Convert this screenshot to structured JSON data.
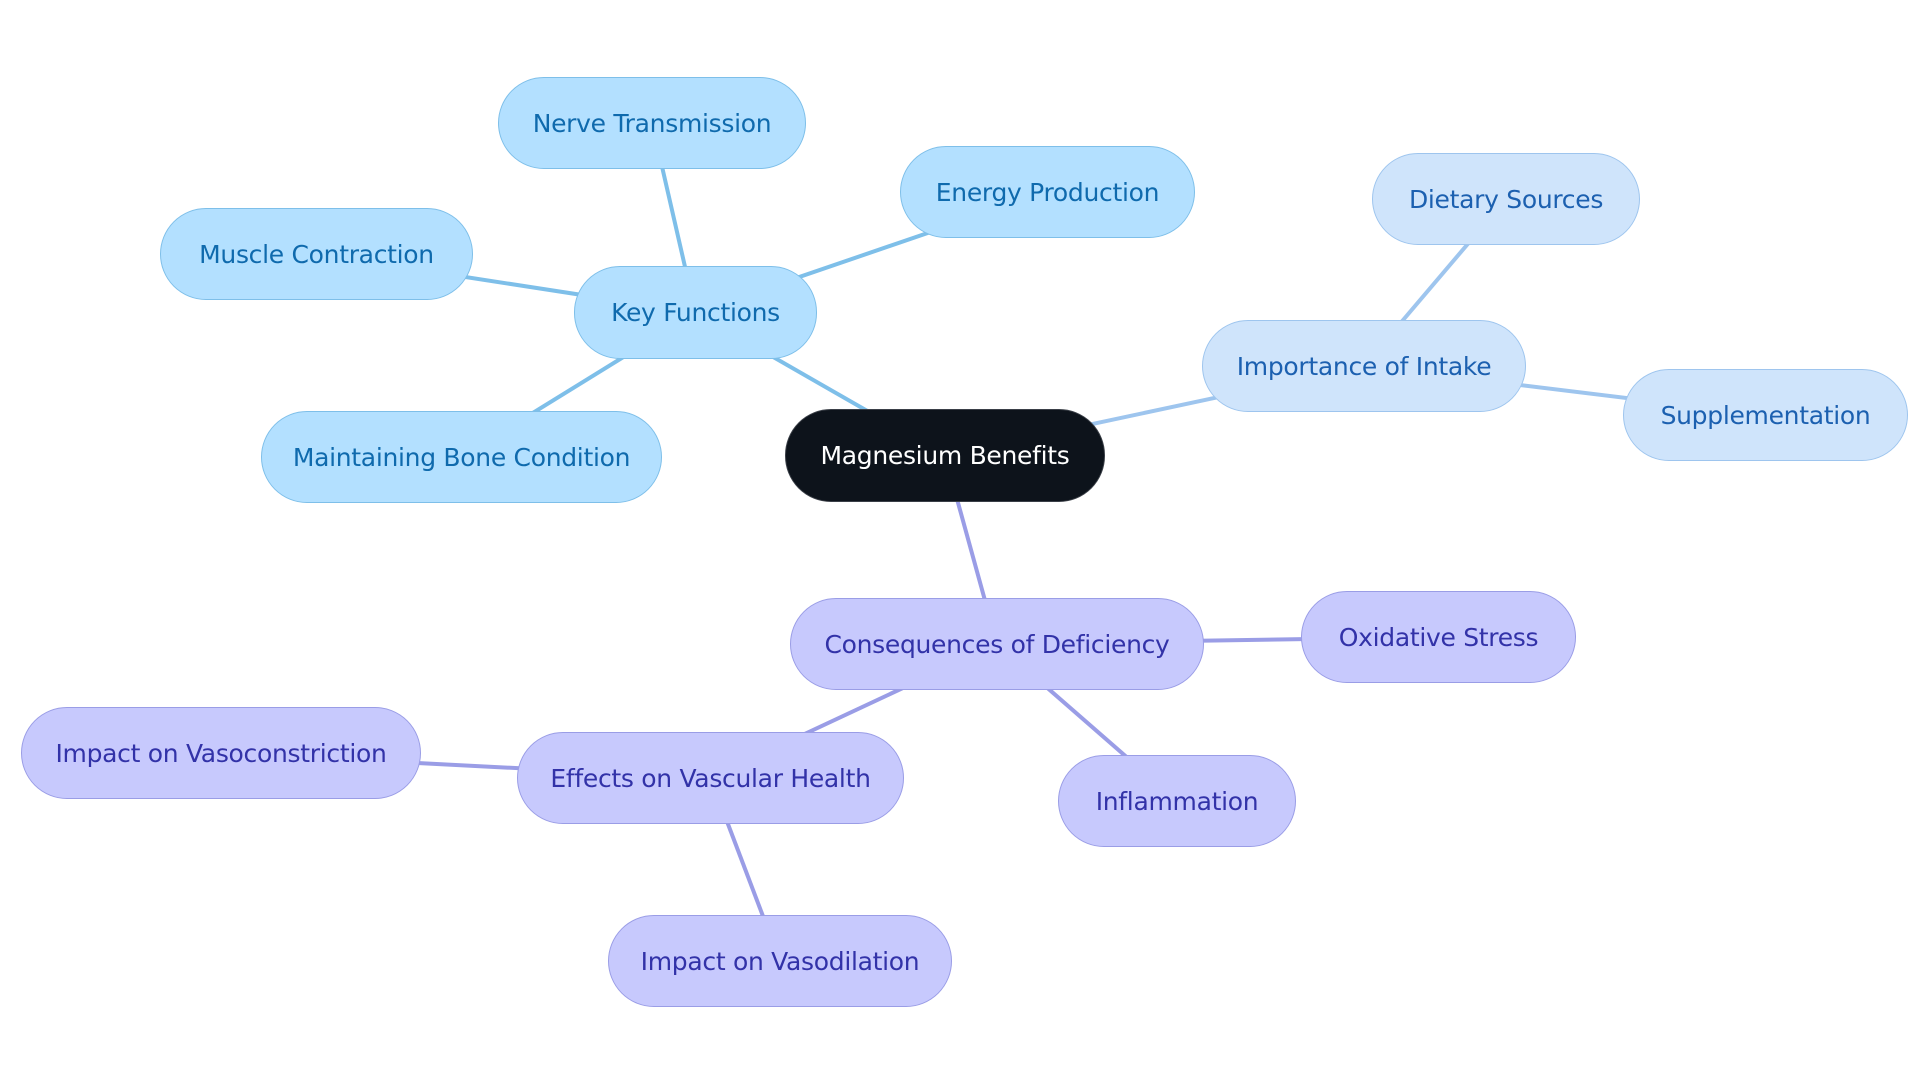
{
  "diagram": {
    "type": "mind-map",
    "colors": {
      "root_fill": "#0d131b",
      "key_functions_fill": "#b3e0ff",
      "key_functions_line": "#7ebfe9",
      "intake_fill": "#cfe4fb",
      "intake_line": "#9ec5ee",
      "deficiency_fill": "#c7c9fd",
      "deficiency_line": "#9a9de6"
    },
    "root": {
      "id": "root",
      "label": "Magnesium Benefits"
    },
    "nodes": [
      {
        "id": "key-functions",
        "label": "Key Functions",
        "parent": "root",
        "branch": "kf"
      },
      {
        "id": "nerve-transmission",
        "label": "Nerve Transmission",
        "parent": "key-functions",
        "branch": "kf"
      },
      {
        "id": "energy-production",
        "label": "Energy Production",
        "parent": "key-functions",
        "branch": "kf"
      },
      {
        "id": "muscle-contraction",
        "label": "Muscle Contraction",
        "parent": "key-functions",
        "branch": "kf"
      },
      {
        "id": "maintaining-bone-condition",
        "label": "Maintaining Bone Condition",
        "parent": "key-functions",
        "branch": "kf"
      },
      {
        "id": "importance-of-intake",
        "label": "Importance of Intake",
        "parent": "root",
        "branch": "imp"
      },
      {
        "id": "dietary-sources",
        "label": "Dietary Sources",
        "parent": "importance-of-intake",
        "branch": "imp"
      },
      {
        "id": "supplementation",
        "label": "Supplementation",
        "parent": "importance-of-intake",
        "branch": "imp"
      },
      {
        "id": "consequences-of-deficiency",
        "label": "Consequences of Deficiency",
        "parent": "root",
        "branch": "def"
      },
      {
        "id": "oxidative-stress",
        "label": "Oxidative Stress",
        "parent": "consequences-of-deficiency",
        "branch": "def"
      },
      {
        "id": "inflammation",
        "label": "Inflammation",
        "parent": "consequences-of-deficiency",
        "branch": "def"
      },
      {
        "id": "effects-on-vascular-health",
        "label": "Effects on Vascular Health",
        "parent": "consequences-of-deficiency",
        "branch": "def"
      },
      {
        "id": "impact-on-vasoconstriction",
        "label": "Impact on Vasoconstriction",
        "parent": "effects-on-vascular-health",
        "branch": "def"
      },
      {
        "id": "impact-on-vasodilation",
        "label": "Impact on Vasodilation",
        "parent": "effects-on-vascular-health",
        "branch": "def"
      }
    ]
  }
}
